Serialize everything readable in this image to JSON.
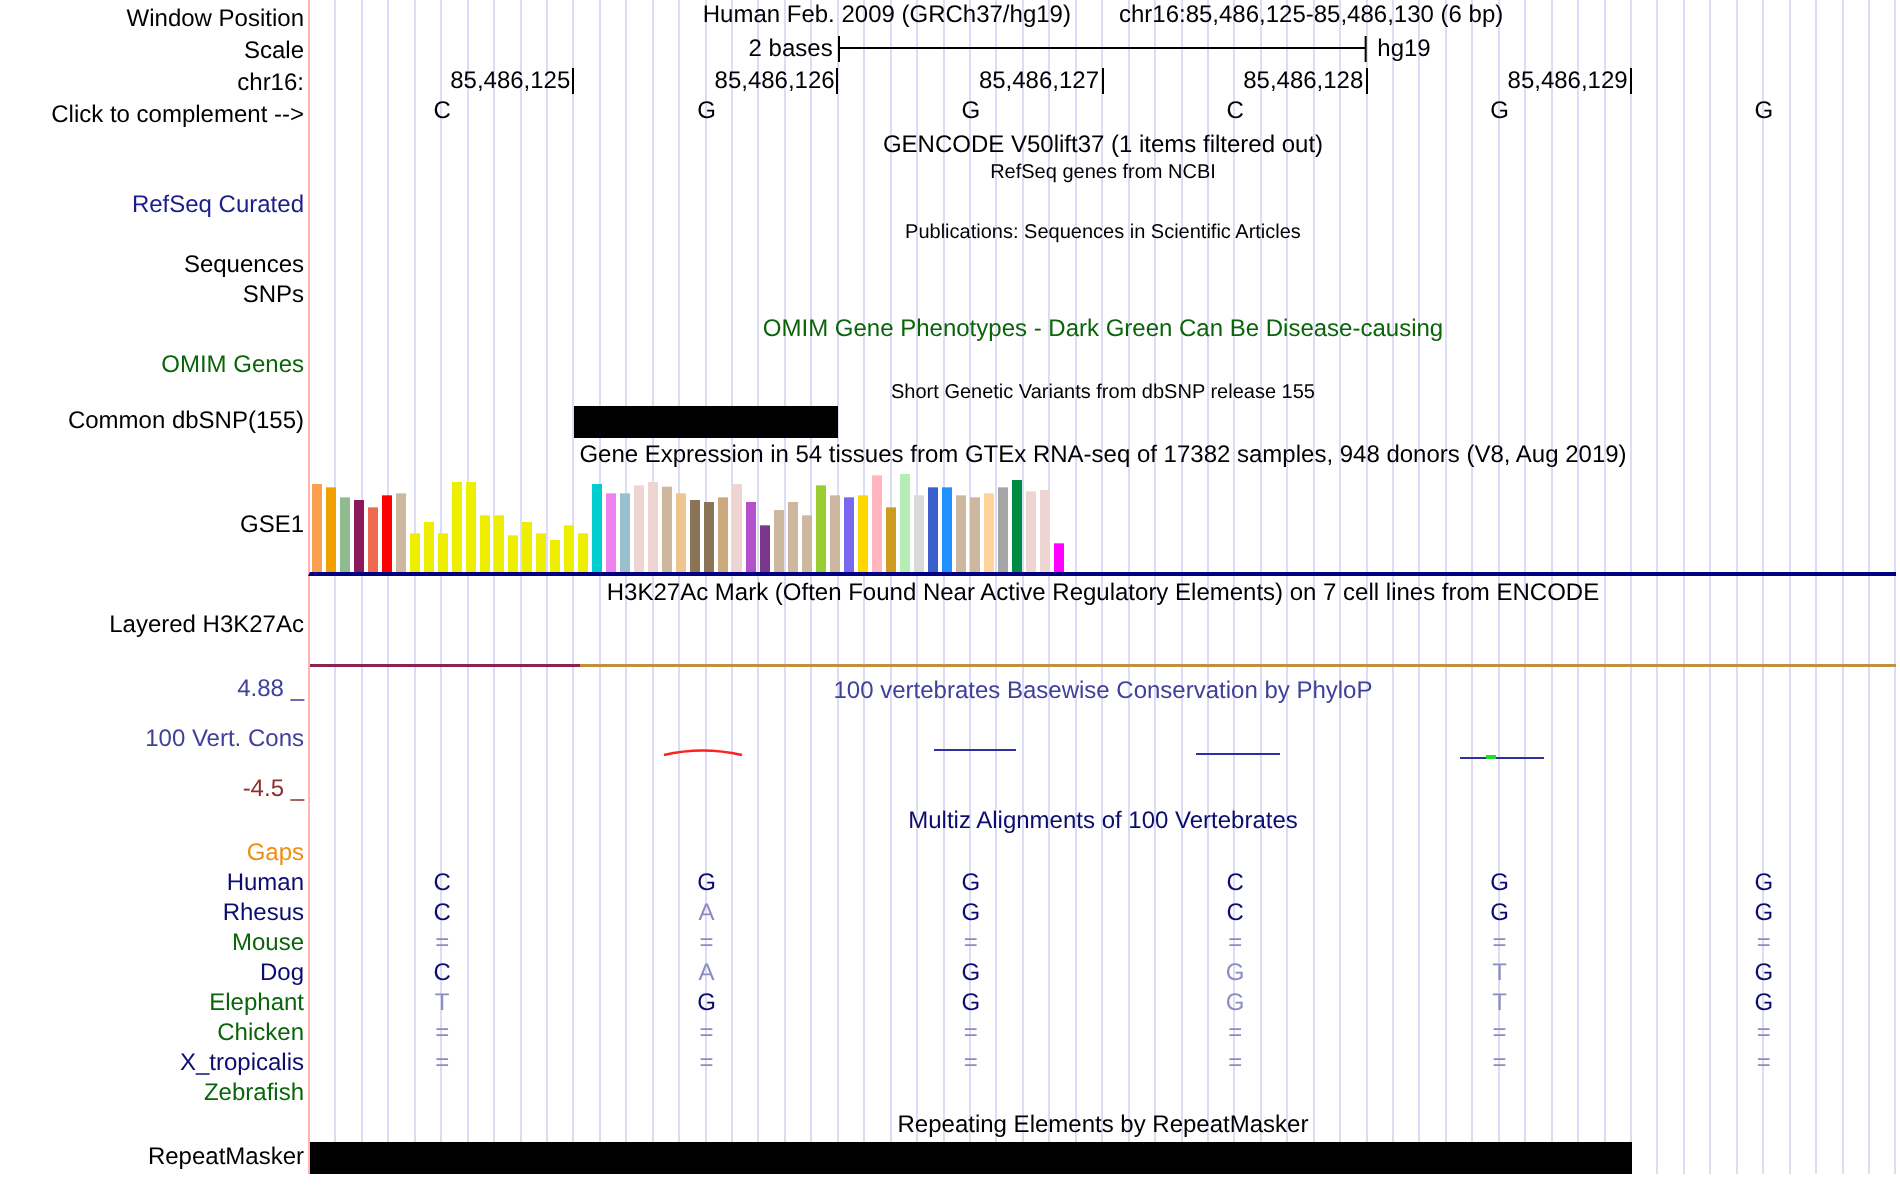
{
  "header": {
    "window_position": {
      "label": "Window Position",
      "assembly": "Human Feb. 2009 (GRCh37/hg19)",
      "position": "chr16:85,486,125-85,486,130 (6 bp)"
    },
    "scale": {
      "label": "Scale",
      "length": "2 bases",
      "assembly": "hg19"
    },
    "ruler": {
      "label": "chr16:",
      "ticks": [
        "85,486,125",
        "85,486,126",
        "85,486,127",
        "85,486,128",
        "85,486,129"
      ]
    },
    "complement": {
      "label": "Click to complement -->",
      "bases": [
        "C",
        "G",
        "G",
        "C",
        "G",
        "G"
      ]
    }
  },
  "tracks": [
    {
      "kind": "empty",
      "title": {
        "text": "GENCODE V50lift37 (1 items filtered out)",
        "color": "#000000"
      }
    },
    {
      "kind": "empty",
      "description": {
        "text": "RefSeq genes from NCBI",
        "color": "#000000"
      },
      "labels": [
        {
          "text": "RefSeq Curated",
          "color": "#1c1c8c"
        }
      ]
    },
    {
      "kind": "empty",
      "description": {
        "text": "Publications: Sequences in Scientific Articles",
        "color": "#000000"
      },
      "labels": [
        {
          "text": "Sequences",
          "color": "#000000"
        },
        {
          "text": "SNPs",
          "color": "#000000"
        }
      ]
    },
    {
      "kind": "empty",
      "title": {
        "text": "OMIM Gene Phenotypes - Dark Green Can Be Disease-causing",
        "color": "#0a640a"
      },
      "labels": [
        {
          "text": "OMIM Genes",
          "color": "#0a640a"
        }
      ]
    },
    {
      "kind": "features",
      "description": {
        "text": "Short Genetic Variants from dbSNP release 155",
        "color": "#000000"
      },
      "labels": [
        {
          "text": "Common dbSNP(155)",
          "color": "#000000"
        }
      ],
      "covered": [
        false,
        true,
        false,
        false,
        false,
        false
      ]
    },
    {
      "kind": "expression",
      "title": {
        "text": "Gene Expression in 54 tissues from GTEx RNA-seq of 17382 samples, 948 donors (V8, Aug 2019)",
        "color": "#000000"
      },
      "labels": [
        {
          "text": "GSE1",
          "color": "#000000"
        }
      ]
    },
    {
      "kind": "signal",
      "title": {
        "text": "H3K27Ac Mark (Often Found Near Active Regulatory Elements) on 7 cell lines from ENCODE",
        "color": "#000000"
      },
      "labels": [
        {
          "text": "Layered H3K27Ac",
          "color": "#000000"
        }
      ]
    },
    {
      "kind": "wiggle",
      "title": {
        "text": "100 vertebrates Basewise Conservation by PhyloP",
        "color": "#40409a"
      },
      "labels": [
        {
          "text": "4.88 _",
          "color": "#40409a"
        },
        {
          "text": "100 Vert. Cons",
          "color": "#40409a"
        },
        {
          "text": "-4.5 _",
          "color": "#8a3030"
        }
      ]
    },
    {
      "kind": "alignment",
      "title": {
        "text": "Multiz Alignments of 100 Vertebrates",
        "color": "#0c0c70"
      },
      "labels": [
        {
          "text": "Gaps",
          "color": "#f08c10"
        }
      ],
      "species": [
        {
          "name": "Human",
          "color": "#0c0c70",
          "bases": [
            {
              "base": "C",
              "faded": false
            },
            {
              "base": "G",
              "faded": false
            },
            {
              "base": "G",
              "faded": false
            },
            {
              "base": "C",
              "faded": false
            },
            {
              "base": "G",
              "faded": false
            },
            {
              "base": "G",
              "faded": false
            }
          ]
        },
        {
          "name": "Rhesus",
          "color": "#0c0c70",
          "bases": [
            {
              "base": "C",
              "faded": false
            },
            {
              "base": "A",
              "faded": true
            },
            {
              "base": "G",
              "faded": false
            },
            {
              "base": "C",
              "faded": false
            },
            {
              "base": "G",
              "faded": false
            },
            {
              "base": "G",
              "faded": false
            }
          ]
        },
        {
          "name": "Mouse",
          "color": "#0a640a",
          "bases": [
            {
              "base": "=",
              "faded": true
            },
            {
              "base": "=",
              "faded": true
            },
            {
              "base": "=",
              "faded": true
            },
            {
              "base": "=",
              "faded": true
            },
            {
              "base": "=",
              "faded": true
            },
            {
              "base": "=",
              "faded": true
            }
          ]
        },
        {
          "name": "Dog",
          "color": "#0c0c70",
          "bases": [
            {
              "base": "C",
              "faded": false
            },
            {
              "base": "A",
              "faded": true
            },
            {
              "base": "G",
              "faded": false
            },
            {
              "base": "G",
              "faded": true
            },
            {
              "base": "T",
              "faded": true
            },
            {
              "base": "G",
              "faded": false
            }
          ]
        },
        {
          "name": "Elephant",
          "color": "#0a640a",
          "bases": [
            {
              "base": "T",
              "faded": true
            },
            {
              "base": "G",
              "faded": false
            },
            {
              "base": "G",
              "faded": false
            },
            {
              "base": "G",
              "faded": true
            },
            {
              "base": "T",
              "faded": true
            },
            {
              "base": "G",
              "faded": false
            }
          ]
        },
        {
          "name": "Chicken",
          "color": "#0a640a",
          "bases": [
            {
              "base": "=",
              "faded": true
            },
            {
              "base": "=",
              "faded": true
            },
            {
              "base": "=",
              "faded": true
            },
            {
              "base": "=",
              "faded": true
            },
            {
              "base": "=",
              "faded": true
            },
            {
              "base": "=",
              "faded": true
            }
          ]
        },
        {
          "name": "X_tropicalis",
          "color": "#0c0c70",
          "bases": [
            {
              "base": "=",
              "faded": true
            },
            {
              "base": "=",
              "faded": true
            },
            {
              "base": "=",
              "faded": true
            },
            {
              "base": "=",
              "faded": true
            },
            {
              "base": "=",
              "faded": true
            },
            {
              "base": "=",
              "faded": true
            }
          ]
        },
        {
          "name": "Zebrafish",
          "color": "#0a640a"
        }
      ]
    },
    {
      "kind": "features",
      "title": {
        "text": "Repeating Elements by RepeatMasker",
        "color": "#000000"
      },
      "labels": [
        {
          "text": "RepeatMasker",
          "color": "#000000"
        }
      ],
      "covered": [
        true,
        true,
        true,
        true,
        true,
        false
      ]
    }
  ]
}
